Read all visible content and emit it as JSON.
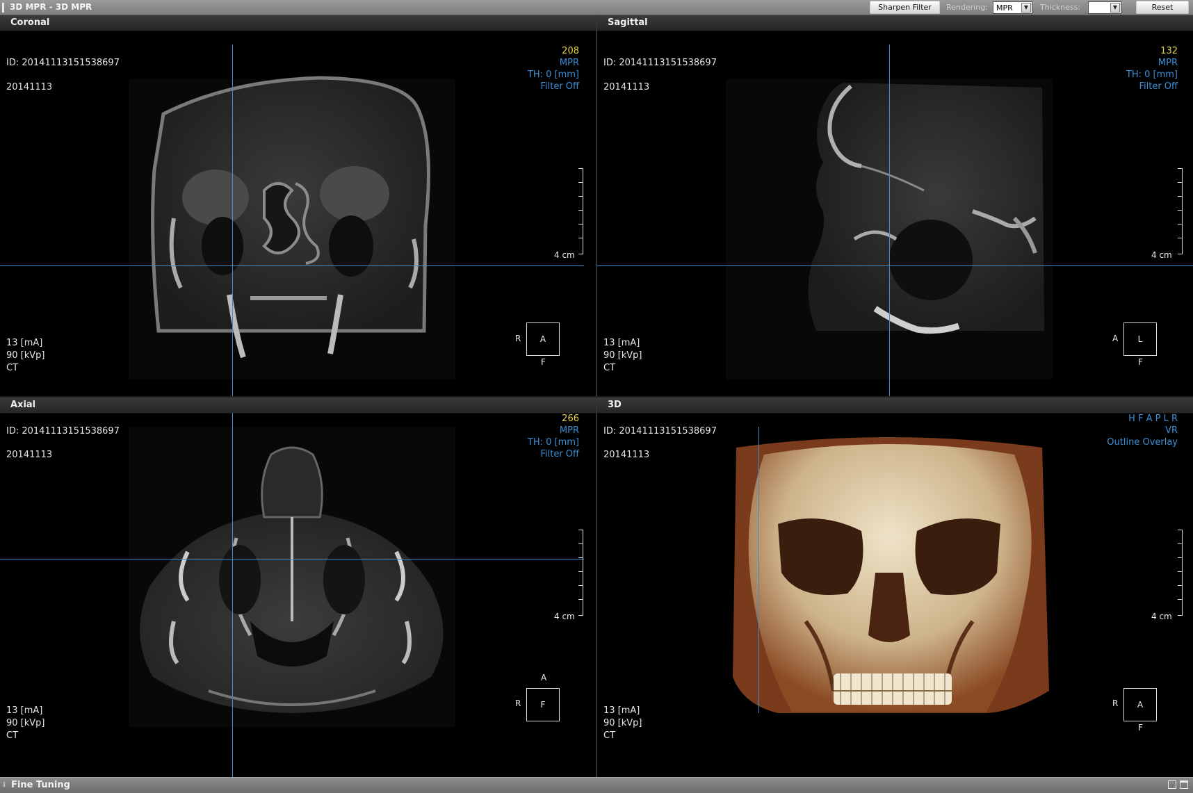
{
  "window": {
    "title": "3D MPR - 3D MPR"
  },
  "toolbar": {
    "sharpen_label": "Sharpen Filter",
    "rendering_label": "Rendering:",
    "rendering_value": "MPR",
    "thickness_label": "Thickness:",
    "thickness_value": "",
    "reset_label": "Reset"
  },
  "viewports": [
    {
      "title": "Coronal",
      "id": "ID: 20141113151538697",
      "date": "20141113",
      "slice": "208",
      "mode": "MPR",
      "th": "TH: 0 [mm]",
      "filter": "Filter Off",
      "ma": "13 [mA]",
      "kvp": "90 [kVp]",
      "modality": "CT",
      "scale": "4 cm",
      "orient": {
        "box": "A",
        "left": "R",
        "bottom": "F"
      }
    },
    {
      "title": "Sagittal",
      "id": "ID: 20141113151538697",
      "date": "20141113",
      "slice": "132",
      "mode": "MPR",
      "th": "TH: 0 [mm]",
      "filter": "Filter Off",
      "ma": "13 [mA]",
      "kvp": "90 [kVp]",
      "modality": "CT",
      "scale": "4 cm",
      "orient": {
        "box": "L",
        "left": "A",
        "bottom": "F"
      }
    },
    {
      "title": "Axial",
      "id": "ID: 20141113151538697",
      "date": "20141113",
      "slice": "266",
      "mode": "MPR",
      "th": "TH: 0 [mm]",
      "filter": "Filter Off",
      "ma": "13 [mA]",
      "kvp": "90 [kVp]",
      "modality": "CT",
      "scale": "4 cm",
      "orient": {
        "box": "F",
        "left": "R",
        "top": "A"
      }
    },
    {
      "title": "3D",
      "id": "ID: 20141113151538697",
      "date": "20141113",
      "directions": "H F A P L R",
      "mode": "VR",
      "overlay": "Outline Overlay",
      "ma": "13 [mA]",
      "kvp": "90 [kVp]",
      "modality": "CT",
      "scale": "4 cm",
      "orient": {
        "box": "A",
        "left": "R",
        "bottom": "F"
      }
    }
  ],
  "bottom": {
    "title": "Fine Tuning"
  },
  "colors": {
    "crosshair": "#3f8fcf",
    "slice_number": "#e6d44a",
    "info": "#3d8fd6"
  }
}
